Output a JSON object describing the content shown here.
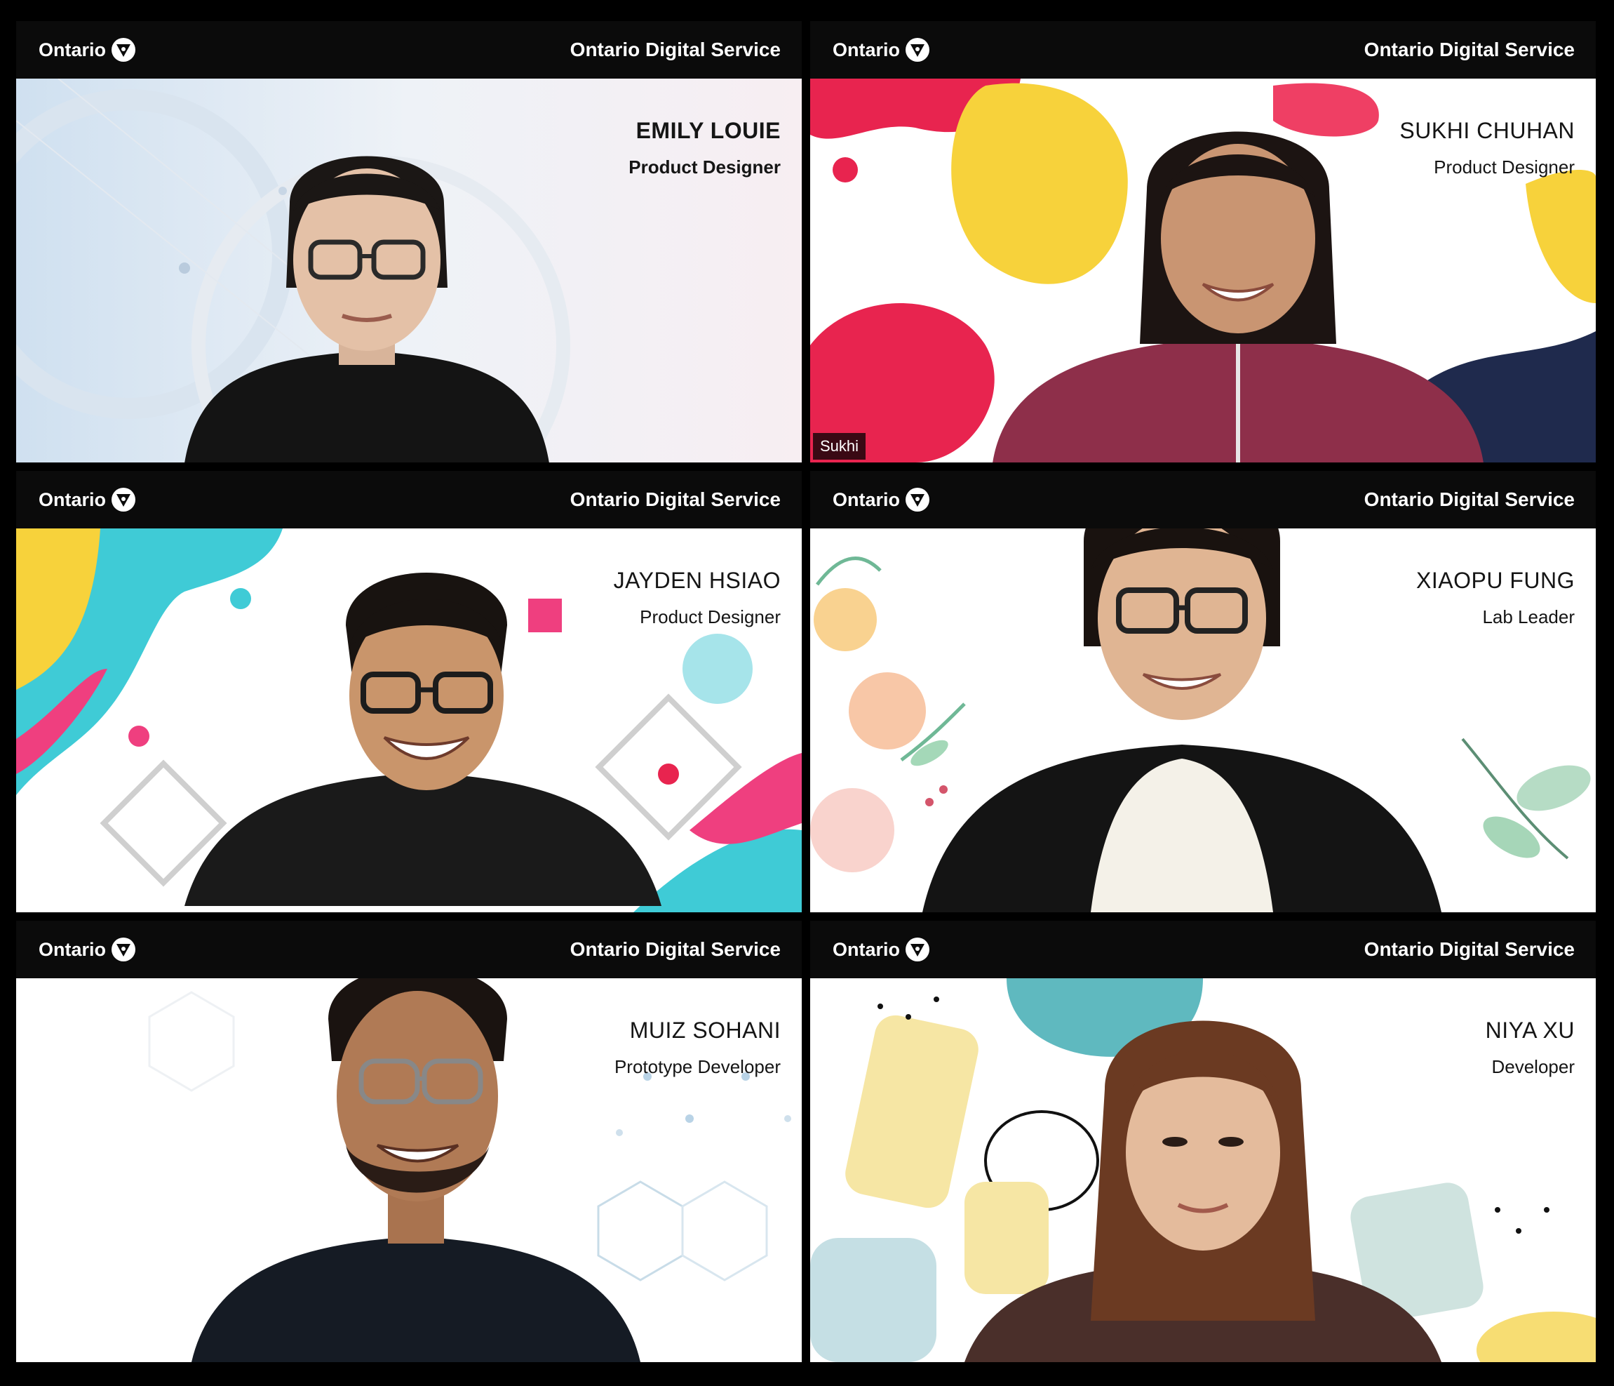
{
  "header": {
    "brand": "Ontario",
    "service": "Ontario Digital Service"
  },
  "participants": [
    {
      "name": "EMILY LOUIE",
      "role": "Product Designer"
    },
    {
      "name": "SUKHI CHUHAN",
      "role": "Product Designer",
      "tag": "Sukhi",
      "active": true
    },
    {
      "name": "JAYDEN HSIAO",
      "role": "Product Designer"
    },
    {
      "name": "XIAOPU FUNG",
      "role": "Lab Leader"
    },
    {
      "name": "MUIZ SOHANI",
      "role": "Prototype Developer"
    },
    {
      "name": "NIYA XU",
      "role": "Developer"
    }
  ],
  "colors": {
    "active_border": "#d7e68a",
    "header_bg": "#0b0b0b",
    "pink": "#e8244f",
    "yellow": "#f7d23b",
    "cyan": "#3fcbd6",
    "magenta": "#ef3f7f"
  }
}
